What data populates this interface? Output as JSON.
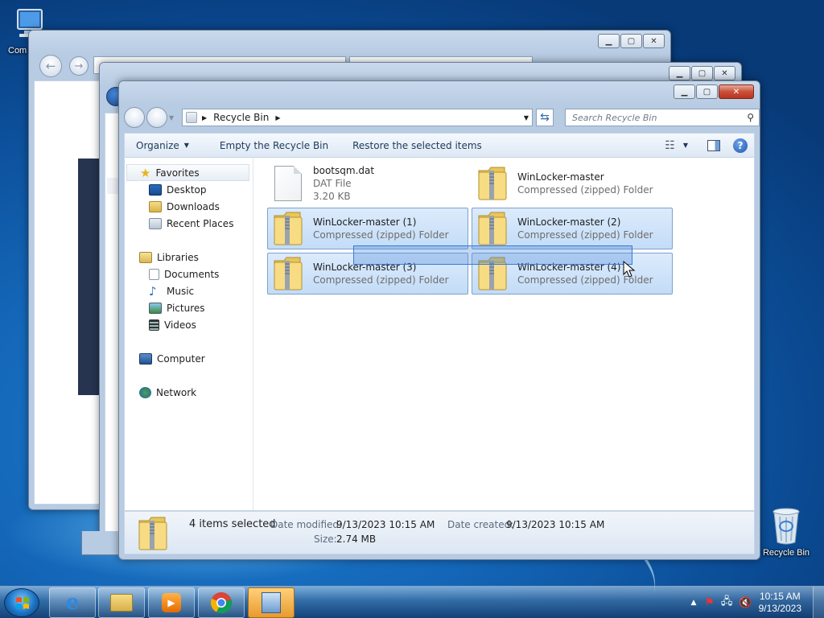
{
  "desktop": {
    "computer_label": "Com",
    "recycle_bin_label": "Recycle Bin"
  },
  "explorer": {
    "address": {
      "location": "Recycle Bin"
    },
    "search": {
      "placeholder": "Search Recycle Bin"
    },
    "toolbar": {
      "organize": "Organize",
      "empty_bin": "Empty the Recycle Bin",
      "restore": "Restore the selected items"
    },
    "nav": {
      "favorites": "Favorites",
      "desktop": "Desktop",
      "downloads": "Downloads",
      "recent": "Recent Places",
      "libraries": "Libraries",
      "documents": "Documents",
      "music": "Music",
      "pictures": "Pictures",
      "videos": "Videos",
      "computer": "Computer",
      "network": "Network"
    },
    "files": [
      {
        "name": "bootsqm.dat",
        "type": "DAT File",
        "size": "3.20 KB",
        "selected": false
      },
      {
        "name": "WinLocker-master",
        "type": "Compressed (zipped) Folder",
        "selected": false
      },
      {
        "name": "WinLocker-master (1)",
        "type": "Compressed (zipped) Folder",
        "selected": true
      },
      {
        "name": "WinLocker-master (2)",
        "type": "Compressed (zipped) Folder",
        "selected": true
      },
      {
        "name": "WinLocker-master (3)",
        "type": "Compressed (zipped) Folder",
        "selected": true
      },
      {
        "name": "WinLocker-master (4)",
        "type": "Compressed (zipped) Folder",
        "selected": true
      }
    ],
    "details": {
      "count": "4 items selected",
      "modified_label": "Date modified:",
      "modified_value": "9/13/2023 10:15 AM",
      "created_label": "Date created:",
      "created_value": "9/13/2023 10:15 AM",
      "size_label": "Size:",
      "size_value": "2.74 MB"
    }
  },
  "taskbar": {
    "time": "10:15 AM",
    "date": "9/13/2023"
  },
  "colors": {
    "selection": "#c3dcf7",
    "selection_border": "#7da2ce",
    "close_button": "#c9503a"
  }
}
